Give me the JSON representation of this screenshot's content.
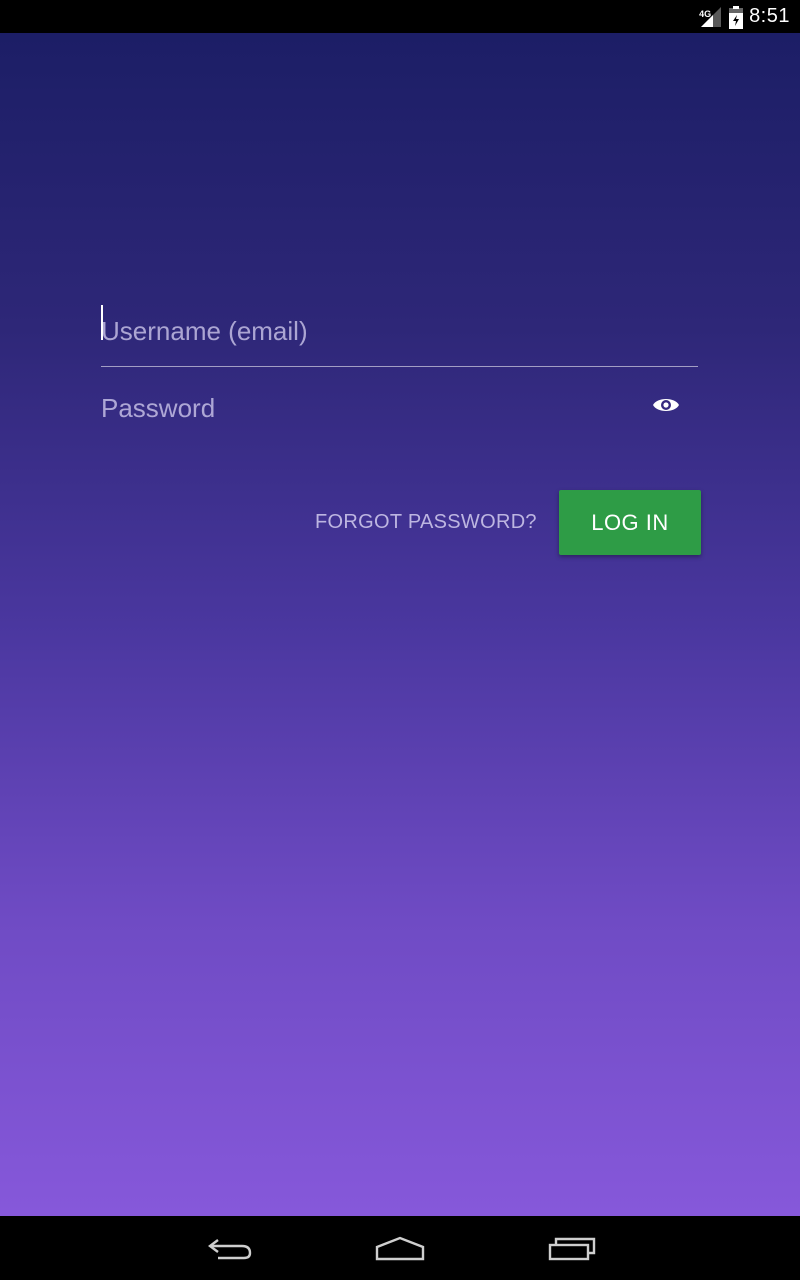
{
  "status_bar": {
    "network": "4G",
    "time": "8:51",
    "icons": [
      "signal-icon",
      "battery-icon"
    ]
  },
  "login": {
    "username_placeholder": "Username (email)",
    "username_value": "",
    "password_placeholder": "Password",
    "password_value": "",
    "forgot_label": "FORGOT PASSWORD?",
    "login_label": "LOG IN",
    "show_password_icon": "eye-icon"
  },
  "nav_bar": {
    "buttons": [
      "back-icon",
      "home-icon",
      "recents-icon"
    ]
  },
  "colors": {
    "gradient_top": "#1c1e66",
    "gradient_bottom": "#8658da",
    "login_button": "#2e9c46"
  }
}
